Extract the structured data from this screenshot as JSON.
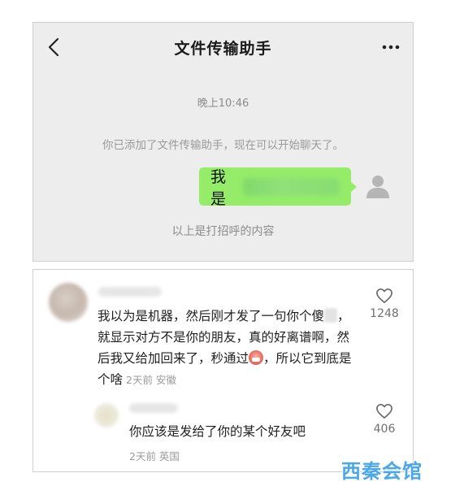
{
  "chat": {
    "title": "文件传输助手",
    "time": "晚上10:46",
    "system_message": "你已添加了文件传输助手，现在可以开始聊天了。",
    "bubble_text": "我是",
    "footnote": "以上是打招呼的内容",
    "icons": {
      "back": "chevron-left-icon",
      "more": "more-dots-icon",
      "avatar": "default-avatar-icon"
    },
    "colors": {
      "bubble": "#95ec69",
      "background": "#ededed"
    }
  },
  "comments": [
    {
      "text_parts": [
        "我以为是机器，然后刚才发了一句你个傻",
        "，就显示对方不是你的朋友，真的好离谱啊，然后我又给加回来了，秒通过",
        "，所以它到底是个啥"
      ],
      "meta": "2天前 安徽",
      "likes": "1248"
    },
    {
      "text": "你应该是发给了你的某个好友吧",
      "meta": "2天前 英国",
      "likes": "406"
    }
  ],
  "watermark": "西秦会馆"
}
